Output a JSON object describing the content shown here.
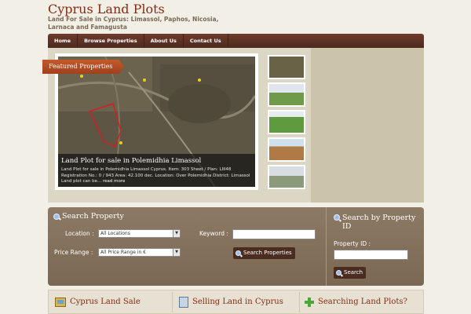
{
  "header": {
    "title": "Cyprus Land Plots",
    "description": "Land For Sale in Cyprus: Limassol, Paphos, Nicosia, Larnaca and Famagusta"
  },
  "nav": [
    {
      "label": "Home"
    },
    {
      "label": "Browse Properties"
    },
    {
      "label": "About Us"
    },
    {
      "label": "Contact Us"
    }
  ],
  "featured": {
    "label": "Featured Properties",
    "title": "Land Plot for sale in Polemidhia Limassol",
    "text": "Land Plot for sale in Polemidhia Limassol Cyprus. Item: 303 Sheet / Plan: LIII48 Registration No.: 0 / 943 Area: 42.100 dec. Location: Over Polemidhia District: Limassol Land plot can be...",
    "more": "read more",
    "thumbs": [
      {
        "name": "thumb-aerial",
        "color": "#6a6246"
      },
      {
        "name": "thumb-field-1",
        "color": "#6f9a4a"
      },
      {
        "name": "thumb-field-2",
        "color": "#5e9a3e"
      },
      {
        "name": "thumb-field-3",
        "color": "#b07a46"
      },
      {
        "name": "thumb-field-4",
        "color": "#8a9a7a"
      }
    ]
  },
  "search": {
    "heading": "Search Property",
    "location_label": "Location :",
    "location_value": "All Locations",
    "keyword_label": "Keyword :",
    "price_label": "Price Range :",
    "price_value": "All Price Range in €",
    "submit_label": "Search Properties"
  },
  "search_id": {
    "heading": "Search by Property ID",
    "field_label": "Property ID :",
    "submit_label": "Search"
  },
  "bottom": [
    {
      "title": "Cyprus Land Sale",
      "icon": "house-icon"
    },
    {
      "title": "Selling Land in Cyprus",
      "icon": "document-icon"
    },
    {
      "title": "Searching Land Plots?",
      "icon": "plus-icon"
    }
  ]
}
